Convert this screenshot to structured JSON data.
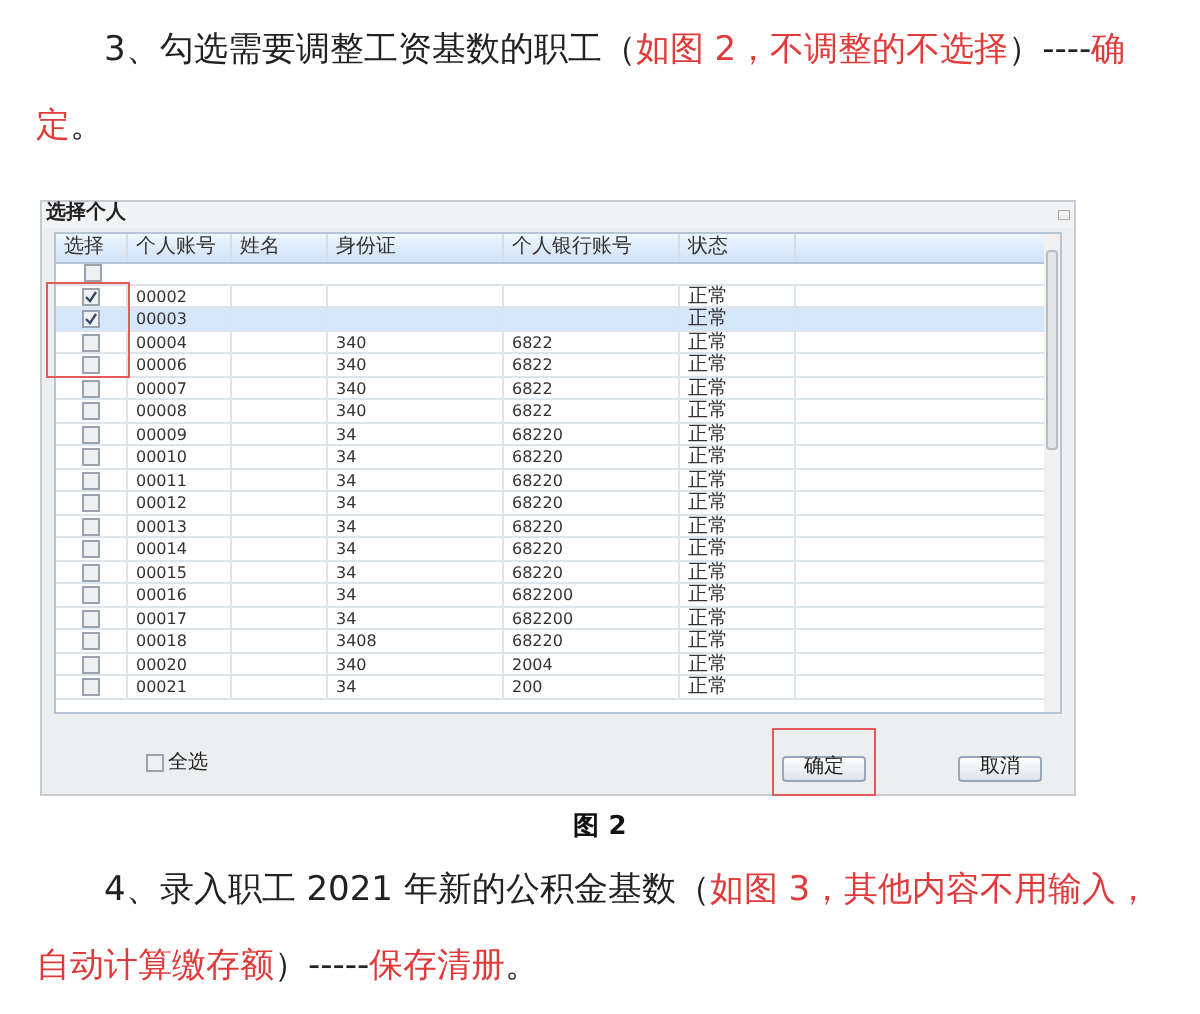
{
  "paragraph_1": {
    "segments": [
      {
        "text": "3、勾选需要调整工资基数的职工（",
        "kind": "plain"
      },
      {
        "text": "如图 2，不调整的不选择",
        "kind": "emphasis"
      },
      {
        "text": "）----",
        "kind": "plain"
      },
      {
        "text": "确定",
        "kind": "emphasis"
      },
      {
        "text": "。",
        "kind": "plain"
      }
    ]
  },
  "dialog": {
    "title": "选择个人",
    "columns": [
      "选择",
      "个人账号",
      "姓名",
      "身份证",
      "个人银行账号",
      "状态"
    ],
    "header_checkbox": {
      "checked": false
    },
    "rows": [
      {
        "id": "00002",
        "id_card": "",
        "bank": "",
        "status": "正常",
        "checked": true,
        "selected": false
      },
      {
        "id": "00003",
        "id_card": "",
        "bank": "",
        "status": "正常",
        "checked": true,
        "selected": true
      },
      {
        "id": "00004",
        "id_card": "340",
        "bank": "6822",
        "status": "正常",
        "checked": false,
        "selected": false
      },
      {
        "id": "00006",
        "id_card": "340",
        "bank": "6822",
        "status": "正常",
        "checked": false,
        "selected": false
      },
      {
        "id": "00007",
        "id_card": "340",
        "bank": "6822",
        "status": "正常",
        "checked": false,
        "selected": false
      },
      {
        "id": "00008",
        "id_card": "340",
        "bank": "6822",
        "status": "正常",
        "checked": false,
        "selected": false
      },
      {
        "id": "00009",
        "id_card": "34",
        "bank": "68220",
        "status": "正常",
        "checked": false,
        "selected": false
      },
      {
        "id": "00010",
        "id_card": "34",
        "bank": "68220",
        "status": "正常",
        "checked": false,
        "selected": false
      },
      {
        "id": "00011",
        "id_card": "34",
        "bank": "68220",
        "status": "正常",
        "checked": false,
        "selected": false
      },
      {
        "id": "00012",
        "id_card": "34",
        "bank": "68220",
        "status": "正常",
        "checked": false,
        "selected": false
      },
      {
        "id": "00013",
        "id_card": "34",
        "bank": "68220",
        "status": "正常",
        "checked": false,
        "selected": false
      },
      {
        "id": "00014",
        "id_card": "34",
        "bank": "68220",
        "status": "正常",
        "checked": false,
        "selected": false
      },
      {
        "id": "00015",
        "id_card": "34",
        "bank": "68220",
        "status": "正常",
        "checked": false,
        "selected": false
      },
      {
        "id": "00016",
        "id_card": "34",
        "bank": "682200",
        "status": "正常",
        "checked": false,
        "selected": false
      },
      {
        "id": "00017",
        "id_card": "34",
        "bank": "682200",
        "status": "正常",
        "checked": false,
        "selected": false
      },
      {
        "id": "00018",
        "id_card": "3408",
        "bank": "68220",
        "status": "正常",
        "checked": false,
        "selected": false
      },
      {
        "id": "00020",
        "id_card": "340",
        "bank": "2004",
        "status": "正常",
        "checked": false,
        "selected": false
      },
      {
        "id": "00021",
        "id_card": "34",
        "bank": "200",
        "status": "正常",
        "checked": false,
        "selected": false
      }
    ],
    "select_all": {
      "label": "全选",
      "checked": false
    },
    "buttons": [
      {
        "label": "确定",
        "highlighted": true
      },
      {
        "label": "取消",
        "highlighted": false
      }
    ]
  },
  "caption": "图 2",
  "paragraph_2": {
    "segments": [
      {
        "text": "4、录入职工 2021 年新的公积金基数（",
        "kind": "plain"
      },
      {
        "text": "如图 3，其他内容不用输入，自动计算缴存额",
        "kind": "emphasis"
      },
      {
        "text": "）-----",
        "kind": "plain"
      },
      {
        "text": "保存清册",
        "kind": "emphasis"
      },
      {
        "text": "。",
        "kind": "plain"
      }
    ]
  }
}
